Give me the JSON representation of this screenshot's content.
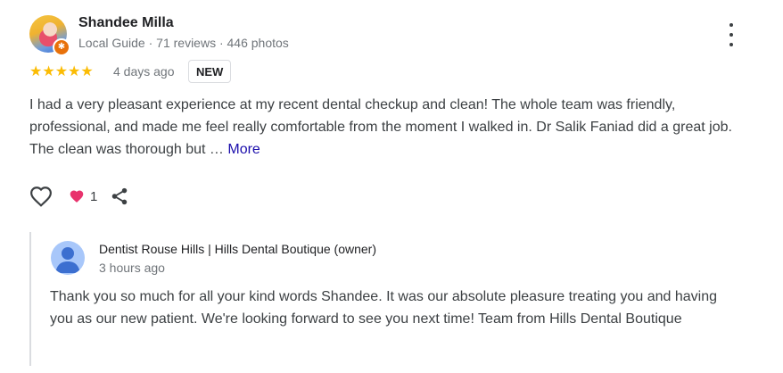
{
  "review": {
    "author": {
      "name": "Shandee Milla",
      "meta": "Local Guide · 71 reviews · 446 photos"
    },
    "rating": 5,
    "stars_text": "★★★★★",
    "date": "4 days ago",
    "badge": "NEW",
    "text": "I had a very pleasant experience at my recent dental checkup and clean! The whole team was friendly, professional, and made me feel really comfortable from the moment I walked in. Dr Salik Faniad did a great job. The clean was thorough but …",
    "more_label": "More",
    "reaction_count": "1"
  },
  "reply": {
    "owner_name": "Dentist Rouse Hills | Hills Dental Boutique (owner)",
    "time": "3 hours ago",
    "text": "Thank you so much for all your kind words Shandee. It was our absolute pleasure treating you and having you as our new patient. We're looking forward to see you next time! Team from Hills Dental Boutique"
  },
  "colors": {
    "star": "#fbbc04",
    "heart": "#e8336d",
    "link": "#1a0dab",
    "guide_badge": "#e8710a"
  },
  "icons": [
    "local-guide-badge-icon",
    "more-options-icon",
    "heart-outline-icon",
    "heart-filled-icon",
    "share-icon",
    "owner-avatar-icon"
  ]
}
